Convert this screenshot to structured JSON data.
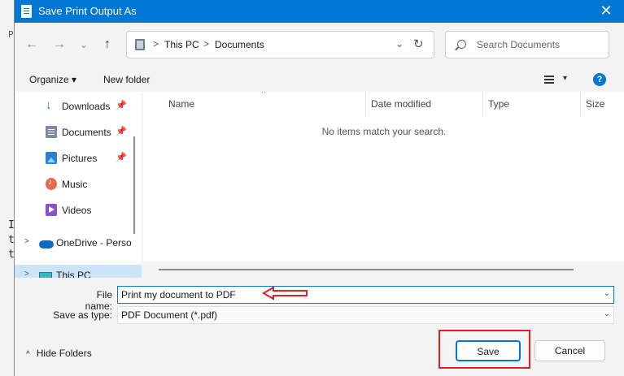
{
  "background_app": {
    "glyphs": [
      "P",
      "I",
      "t",
      "t"
    ]
  },
  "dialog": {
    "title": "Save Print Output As",
    "close_glyph": "✕"
  },
  "nav": {
    "back": "←",
    "forward": "→",
    "recent": "⌄",
    "up": "↑"
  },
  "address": {
    "crumbs": [
      "This PC",
      "Documents"
    ],
    "separator": ">",
    "dropdown": "⌄",
    "refresh": "↻"
  },
  "search": {
    "placeholder": "Search Documents"
  },
  "toolbar": {
    "organize_label": "Organize ▾",
    "new_folder_label": "New folder",
    "view_dropdown": "▾",
    "help": "?"
  },
  "sidebar": {
    "items": [
      {
        "label": "Downloads",
        "icon": "download-icon",
        "pinned": true
      },
      {
        "label": "Documents",
        "icon": "documents-icon",
        "pinned": true
      },
      {
        "label": "Pictures",
        "icon": "pictures-icon",
        "pinned": true
      },
      {
        "label": "Music",
        "icon": "music-icon",
        "pinned": false
      },
      {
        "label": "Videos",
        "icon": "videos-icon",
        "pinned": false
      },
      {
        "label": "OneDrive - Perso",
        "icon": "onedrive-icon",
        "pinned": false,
        "expandable": true
      },
      {
        "label": "This PC",
        "icon": "this-pc-icon",
        "pinned": false,
        "expandable": true,
        "selected": true
      }
    ],
    "pin_glyph": "📌",
    "expand_glyph": ">"
  },
  "file_list": {
    "columns": [
      "Name",
      "Date modified",
      "Type",
      "Size"
    ],
    "sort_glyph": "^",
    "empty_message": "No items match your search."
  },
  "form": {
    "file_name_label": "File name:",
    "file_name_value": "Print my document to PDF",
    "save_as_type_label": "Save as type:",
    "save_as_type_value": "PDF Document (*.pdf)",
    "dropdown_glyph": "⌄"
  },
  "footer": {
    "hide_folders_label": "Hide Folders",
    "hide_folders_glyph": "^",
    "save_label": "Save",
    "cancel_label": "Cancel"
  },
  "annotations": {
    "highlight_color": "#d9222a"
  },
  "colors": {
    "titlebar": "#0078d4",
    "accent": "#0078d4",
    "selection": "#cce4f7"
  }
}
